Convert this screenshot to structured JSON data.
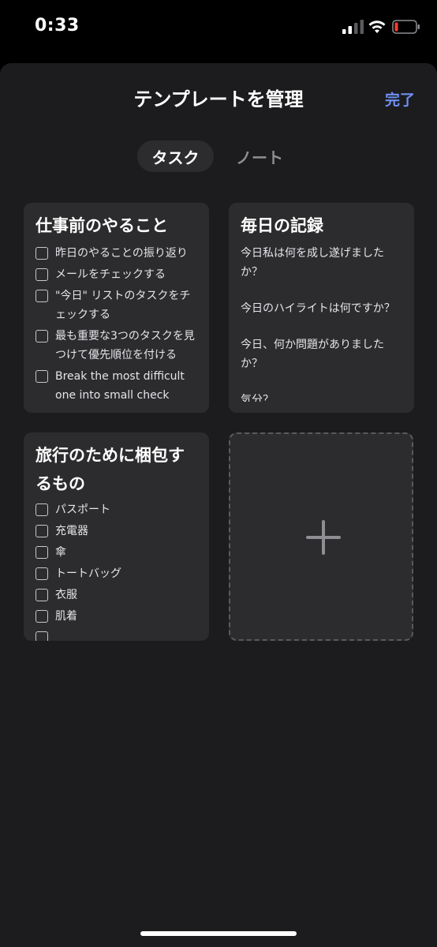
{
  "status": {
    "time": "0:33"
  },
  "header": {
    "title": "テンプレートを管理",
    "done_label": "完了"
  },
  "tabs": [
    {
      "label": "タスク",
      "active": true
    },
    {
      "label": "ノート",
      "active": false
    }
  ],
  "templates": [
    {
      "title": "仕事前のやること",
      "items": [
        "昨日のやることの振り返り",
        "メールをチェックする",
        "\"今日\" リストのタスクをチェックする",
        "最も重要な3つのタスクを見つけて優先順位を付ける",
        "Break the most difficult one into small check"
      ]
    },
    {
      "title": "毎日の記録",
      "lines": [
        "今日私は何を成し遂げましたか？",
        "今日のハイライトは何ですか？",
        "今日、何か問題がありましたか？",
        "気分？"
      ]
    },
    {
      "title": "旅行のために梱包するもの",
      "items": [
        "パスポート",
        "充電器",
        "傘",
        "トートバッグ",
        "衣服",
        "肌着",
        ""
      ]
    }
  ],
  "colors": {
    "accent": "#6e8ff0",
    "card": "#2c2c2e",
    "sheet": "#1c1c1e"
  },
  "icons": {
    "add": "plus-icon"
  }
}
